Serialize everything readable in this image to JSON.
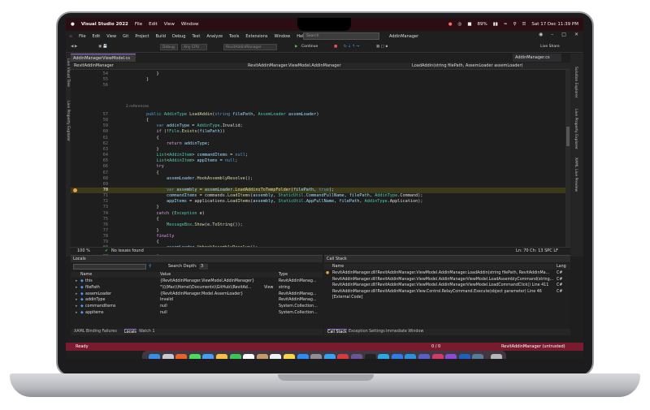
{
  "menubar": {
    "app": "Visual Studio 2022",
    "items": [
      "File",
      "Edit",
      "View",
      "Window"
    ],
    "battery": "89%",
    "datetime": "Sat 17 Dec  11:39 PM"
  },
  "vsmenu": {
    "items": [
      "File",
      "Edit",
      "View",
      "Git",
      "Project",
      "Build",
      "Debug",
      "Test",
      "Analyze",
      "Tools",
      "Extensions",
      "Window",
      "Help"
    ],
    "search_placeholder": "Search",
    "solution": "AddinManager"
  },
  "toolbar": {
    "config": "Debug",
    "platform": "Any CPU",
    "project": "RevitAddinManager",
    "continue": "Continue",
    "live_share": "Live Share"
  },
  "tabs": {
    "active": "AddinManagerViewModel.cs",
    "right": "AddinManager.cs"
  },
  "navbar": {
    "left": "RevitAddinManager",
    "middle": "RevitAddinManager.ViewModel.AddinManager",
    "right": "LoadAddin(string filePath, AssemLoader assemLoader)"
  },
  "code": {
    "references": "2 references",
    "lines": [
      {
        "n": "54",
        "indent": "            ",
        "parts": [
          [
            "}",
            ""
          ]
        ]
      },
      {
        "n": "55",
        "indent": "        ",
        "parts": [
          [
            "}",
            ""
          ]
        ]
      },
      {
        "n": "56",
        "indent": "",
        "parts": []
      },
      {
        "n": "57",
        "indent": "        ",
        "parts": [
          [
            "public ",
            "kw"
          ],
          [
            "AddinType ",
            "ty"
          ],
          [
            "LoadAddin",
            "fn"
          ],
          [
            "(",
            ""
          ],
          [
            "string ",
            "kw"
          ],
          [
            "filePath",
            "pa"
          ],
          [
            ", ",
            ""
          ],
          [
            "AssemLoader ",
            "ty"
          ],
          [
            "assemLoader",
            "pa"
          ],
          [
            ")",
            ""
          ]
        ]
      },
      {
        "n": "58",
        "indent": "        ",
        "parts": [
          [
            "{",
            ""
          ]
        ]
      },
      {
        "n": "59",
        "indent": "            ",
        "parts": [
          [
            "var ",
            "kw"
          ],
          [
            "addinType",
            "pa"
          ],
          [
            " = ",
            ""
          ],
          [
            "AddinType",
            "ty"
          ],
          [
            ".Invalid;",
            ""
          ]
        ]
      },
      {
        "n": "60",
        "indent": "            ",
        "parts": [
          [
            "if ",
            "kw2"
          ],
          [
            "(!",
            ""
          ],
          [
            "File",
            "ty"
          ],
          [
            ".",
            ""
          ],
          [
            "Exists",
            "fn"
          ],
          [
            "(",
            ""
          ],
          [
            "filePath",
            "pa"
          ],
          [
            "))",
            ""
          ]
        ]
      },
      {
        "n": "61",
        "indent": "            ",
        "parts": [
          [
            "{",
            ""
          ]
        ]
      },
      {
        "n": "62",
        "indent": "                ",
        "parts": [
          [
            "return ",
            "kw2"
          ],
          [
            "addinType",
            "pa"
          ],
          [
            ";",
            ""
          ]
        ]
      },
      {
        "n": "63",
        "indent": "            ",
        "parts": [
          [
            "}",
            ""
          ]
        ]
      },
      {
        "n": "64",
        "indent": "            ",
        "parts": [
          [
            "List",
            "ty"
          ],
          [
            "<",
            ""
          ],
          [
            "AddinItem",
            "ty"
          ],
          [
            "> ",
            ""
          ],
          [
            "commandItems",
            "pa"
          ],
          [
            " = ",
            ""
          ],
          [
            "null",
            "kw"
          ],
          [
            ";",
            ""
          ]
        ]
      },
      {
        "n": "65",
        "indent": "            ",
        "parts": [
          [
            "List",
            "ty"
          ],
          [
            "<",
            ""
          ],
          [
            "AddinItem",
            "ty"
          ],
          [
            "> ",
            ""
          ],
          [
            "appItems",
            "pa"
          ],
          [
            " = ",
            ""
          ],
          [
            "null",
            "kw"
          ],
          [
            ";",
            ""
          ]
        ]
      },
      {
        "n": "66",
        "indent": "            ",
        "parts": [
          [
            "try",
            "kw2"
          ]
        ]
      },
      {
        "n": "67",
        "indent": "            ",
        "parts": [
          [
            "{",
            ""
          ]
        ]
      },
      {
        "n": "68",
        "indent": "                ",
        "parts": [
          [
            "assemLoader",
            "pa"
          ],
          [
            ".",
            ""
          ],
          [
            "HookAssemblyResolve",
            "fn"
          ],
          [
            "();",
            ""
          ]
        ]
      },
      {
        "n": "69",
        "indent": "",
        "parts": []
      },
      {
        "n": "70",
        "indent": "                ",
        "parts": [
          [
            "var ",
            "kw"
          ],
          [
            "assembly",
            "pa"
          ],
          [
            " = ",
            ""
          ],
          [
            "assemLoader",
            "pa"
          ],
          [
            ".",
            ""
          ],
          [
            "LoadAddinsToTempFolder",
            "fn"
          ],
          [
            "(",
            ""
          ],
          [
            "filePath",
            "pa"
          ],
          [
            ", ",
            ""
          ],
          [
            "true",
            "kw"
          ],
          [
            ");",
            ""
          ]
        ],
        "highlight": true
      },
      {
        "n": "71",
        "indent": "                ",
        "parts": [
          [
            "commandItems",
            "pa"
          ],
          [
            " = commands.",
            ""
          ],
          [
            "LoadItems",
            "fn"
          ],
          [
            "(",
            ""
          ],
          [
            "assembly",
            "pa"
          ],
          [
            ", ",
            ""
          ],
          [
            "StaticUtil",
            "ty"
          ],
          [
            ".",
            ""
          ],
          [
            "CommandFullName",
            "pa"
          ],
          [
            ", ",
            ""
          ],
          [
            "filePath",
            "pa"
          ],
          [
            ", ",
            ""
          ],
          [
            "AddinType",
            "ty"
          ],
          [
            ".Command);",
            ""
          ]
        ]
      },
      {
        "n": "72",
        "indent": "                ",
        "parts": [
          [
            "appItems",
            "pa"
          ],
          [
            " = applications.",
            ""
          ],
          [
            "LoadItems",
            "fn"
          ],
          [
            "(",
            ""
          ],
          [
            "assembly",
            "pa"
          ],
          [
            ", ",
            ""
          ],
          [
            "StaticUtil",
            "ty"
          ],
          [
            ".",
            ""
          ],
          [
            "AppFullName",
            "pa"
          ],
          [
            ", ",
            ""
          ],
          [
            "filePath",
            "pa"
          ],
          [
            ", ",
            ""
          ],
          [
            "AddinType",
            "ty"
          ],
          [
            ".Application);",
            ""
          ]
        ]
      },
      {
        "n": "73",
        "indent": "            ",
        "parts": [
          [
            "}",
            ""
          ]
        ]
      },
      {
        "n": "74",
        "indent": "            ",
        "parts": [
          [
            "catch ",
            "kw2"
          ],
          [
            "(",
            ""
          ],
          [
            "Exception ",
            "ty"
          ],
          [
            "e",
            ""
          ],
          [
            ")",
            ""
          ]
        ]
      },
      {
        "n": "75",
        "indent": "            ",
        "parts": [
          [
            "{",
            ""
          ]
        ]
      },
      {
        "n": "76",
        "indent": "                ",
        "parts": [
          [
            "MessageBox",
            "ty"
          ],
          [
            ".",
            ""
          ],
          [
            "Show",
            "fn"
          ],
          [
            "(e.",
            ""
          ],
          [
            "ToString",
            "fn"
          ],
          [
            "());",
            ""
          ]
        ]
      },
      {
        "n": "77",
        "indent": "            ",
        "parts": [
          [
            "}",
            ""
          ]
        ]
      },
      {
        "n": "78",
        "indent": "            ",
        "parts": [
          [
            "finally",
            "kw2"
          ]
        ]
      },
      {
        "n": "79",
        "indent": "            ",
        "parts": [
          [
            "{",
            ""
          ]
        ]
      },
      {
        "n": "80",
        "indent": "                ",
        "parts": [
          [
            "assemLoader",
            "pa"
          ],
          [
            ".",
            ""
          ],
          [
            "UnhookAssemblyResolve",
            "fn"
          ],
          [
            "();",
            ""
          ]
        ]
      },
      {
        "n": "81",
        "indent": "            ",
        "parts": [
          [
            "}",
            ""
          ]
        ]
      },
      {
        "n": "82",
        "indent": "            ",
        "parts": [
          [
            "if ",
            "kw2"
          ],
          [
            "(",
            ""
          ],
          [
            "commandItems",
            "pa"
          ],
          [
            " != ",
            ""
          ],
          [
            "null",
            "kw"
          ],
          [
            " && ",
            ""
          ],
          [
            "commandItems",
            "pa"
          ],
          [
            ".Count > 0)",
            ""
          ]
        ]
      }
    ]
  },
  "editor_status": {
    "zoom": "100 %",
    "issues": "No issues found",
    "position": "Ln: 70   Ch: 13   SPC   LF"
  },
  "locals": {
    "title": "Locals",
    "search": "Search",
    "depth_label": "Search Depth:",
    "depth": "3",
    "headers": [
      "Name",
      "Value",
      "Type"
    ],
    "rows": [
      {
        "name": "this",
        "value": "{RevitAddinManager.ViewModel.AddinManager}",
        "type": "RevitAddinManag..."
      },
      {
        "name": "filePath",
        "value": "\"\\\\\\\\Mac\\\\Home\\\\Documents\\\\GitHub\\\\RevitAd...",
        "type": "string",
        "view": "View"
      },
      {
        "name": "assemLoader",
        "value": "{RevitAddinManager.Model.AssemLoader}",
        "type": "RevitAddinManag..."
      },
      {
        "name": "addinType",
        "value": "Invalid",
        "type": "RevitAddinManag..."
      },
      {
        "name": "commandItems",
        "value": "null",
        "type": "System.Collection..."
      },
      {
        "name": "appItems",
        "value": "null",
        "type": "System.Collection..."
      }
    ],
    "tabs": [
      "XAML Binding Failures",
      "Locals",
      "Watch 1"
    ]
  },
  "callstack": {
    "title": "Call Stack",
    "headers": [
      "Name",
      "Lang"
    ],
    "rows": [
      {
        "name": "RevitAddinManager.dll!RevitAddinManager.ViewModel.AddinManager.LoadAddin(string filePath, RevitAddinMa...",
        "lang": "C#"
      },
      {
        "name": "RevitAddinManager.dll!RevitAddinManager.ViewModel.AddinManagerViewModel.LoadAssemblyCommand(string...",
        "lang": "C#"
      },
      {
        "name": "RevitAddinManager.dll!RevitAddinManager.ViewModel.AddinManagerViewModel.LoadCommandClick() Line 411",
        "lang": "C#"
      },
      {
        "name": "RevitAddinManager.dll!RevitAddinManager.View.Control.RelayCommand.Execute(object parameter) Line 46",
        "lang": "C#"
      },
      {
        "name": "[External Code]",
        "lang": ""
      }
    ],
    "tabs": [
      "Call Stack",
      "Exception Settings",
      "Immediate Window"
    ]
  },
  "statusbar": {
    "ready": "Ready",
    "counts": "0 / 0",
    "project": "RevitAddinManager (untrusted)"
  },
  "sidetabs": {
    "left": [
      "Live Visual Tree",
      "Live Property Explorer"
    ],
    "right": [
      "Solution Explorer",
      "Live Property Explorer",
      "XAML Live Preview"
    ]
  },
  "colors": {
    "accent": "#a56ee0",
    "statusbar": "#7a1a2e",
    "menubar": "#2b0e14"
  }
}
